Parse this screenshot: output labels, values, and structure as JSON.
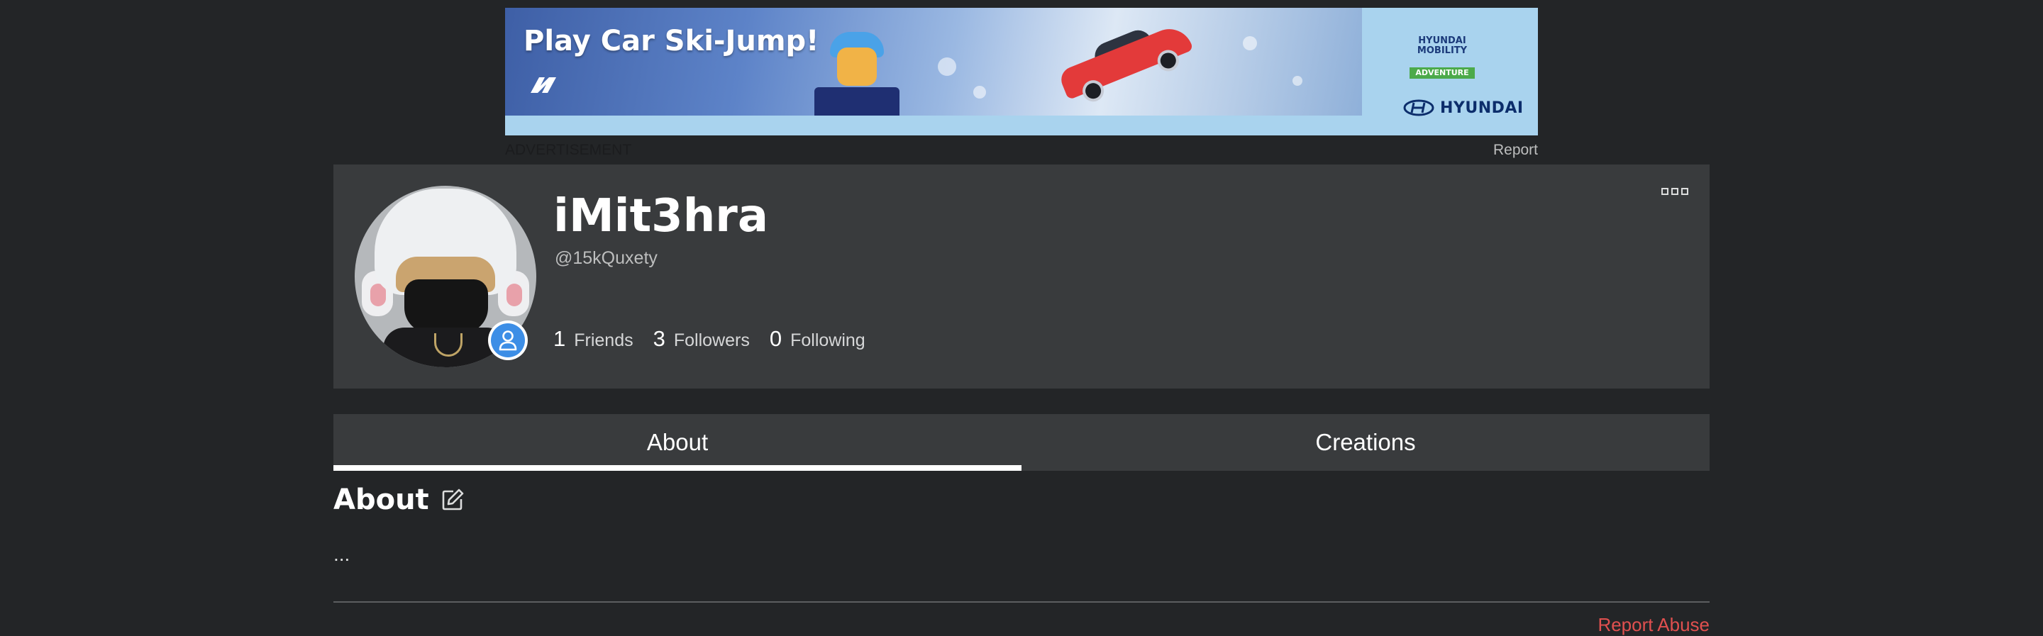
{
  "ad": {
    "headline": "Play Car Ski-Jump!",
    "badge_text": "HYUNDAI\nMOBILITY",
    "badge_ribbon": "ADVENTURE",
    "brand": "HYUNDAI",
    "caption": "ADVERTISEMENT",
    "report_label": "Report"
  },
  "profile": {
    "display_name": "iMit3hra",
    "username": "@15kQuxety",
    "stats": [
      {
        "count": "1",
        "label": "Friends"
      },
      {
        "count": "3",
        "label": "Followers"
      },
      {
        "count": "0",
        "label": "Following"
      }
    ],
    "presence_icon": "user-icon",
    "menu_icon": "more-options-icon"
  },
  "tabs": [
    {
      "label": "About",
      "active": true
    },
    {
      "label": "Creations",
      "active": false
    }
  ],
  "about": {
    "title": "About",
    "body": "...",
    "edit_icon": "edit-icon"
  },
  "footer": {
    "report_abuse": "Report Abuse"
  },
  "colors": {
    "background": "#232527",
    "card": "#393b3d",
    "presence": "#3d8ee6",
    "report_abuse": "#e0504f"
  }
}
